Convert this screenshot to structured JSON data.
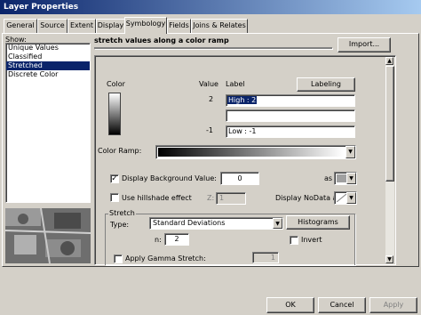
{
  "window": {
    "title": "Layer Properties"
  },
  "tabs": [
    {
      "label": "General",
      "active": false
    },
    {
      "label": "Source",
      "active": false
    },
    {
      "label": "Extent",
      "active": false
    },
    {
      "label": "Display",
      "active": false
    },
    {
      "label": "Symbology",
      "active": true
    },
    {
      "label": "Fields",
      "active": false
    },
    {
      "label": "Joins & Relates",
      "active": false
    }
  ],
  "show": {
    "label": "Show:",
    "items": [
      "Unique Values",
      "Classified",
      "Stretched",
      "Discrete Color"
    ],
    "selected": "Stretched"
  },
  "header": {
    "title": "stretch values along a color ramp",
    "import_label": "Import..."
  },
  "legend": {
    "color_label": "Color",
    "value_label": "Value",
    "label_label": "Label",
    "labeling_button": "Labeling",
    "high_value": "2",
    "high_label": "High : 2",
    "mid_label": "",
    "low_value": "-1",
    "low_label": "Low : -1"
  },
  "color_ramp": {
    "label": "Color Ramp:"
  },
  "background": {
    "checkbox_label": "Display Background Value:",
    "checked": true,
    "value": "0",
    "as_label": "as",
    "color": "#a0a0a0"
  },
  "hillshade": {
    "checkbox_label": "Use hillshade effect",
    "checked": false,
    "z_label": "Z:",
    "z_value": "1",
    "nodata_label": "Display NoData as"
  },
  "stretch": {
    "group_label": "Stretch",
    "type_label": "Type:",
    "type_value": "Standard Deviations",
    "histograms_button": "Histograms",
    "n_label": "n:",
    "n_value": "2",
    "invert_label": "Invert",
    "invert_checked": false,
    "gamma_label": "Apply Gamma Stretch:",
    "gamma_checked": false,
    "gamma_value": "1"
  },
  "footer": {
    "ok": "OK",
    "cancel": "Cancel",
    "apply": "Apply"
  },
  "colors": {
    "selection": "#0a246a",
    "titlebar_start": "#0a246a",
    "titlebar_end": "#a6caf0",
    "dialog_bg": "#d4d0c8"
  }
}
